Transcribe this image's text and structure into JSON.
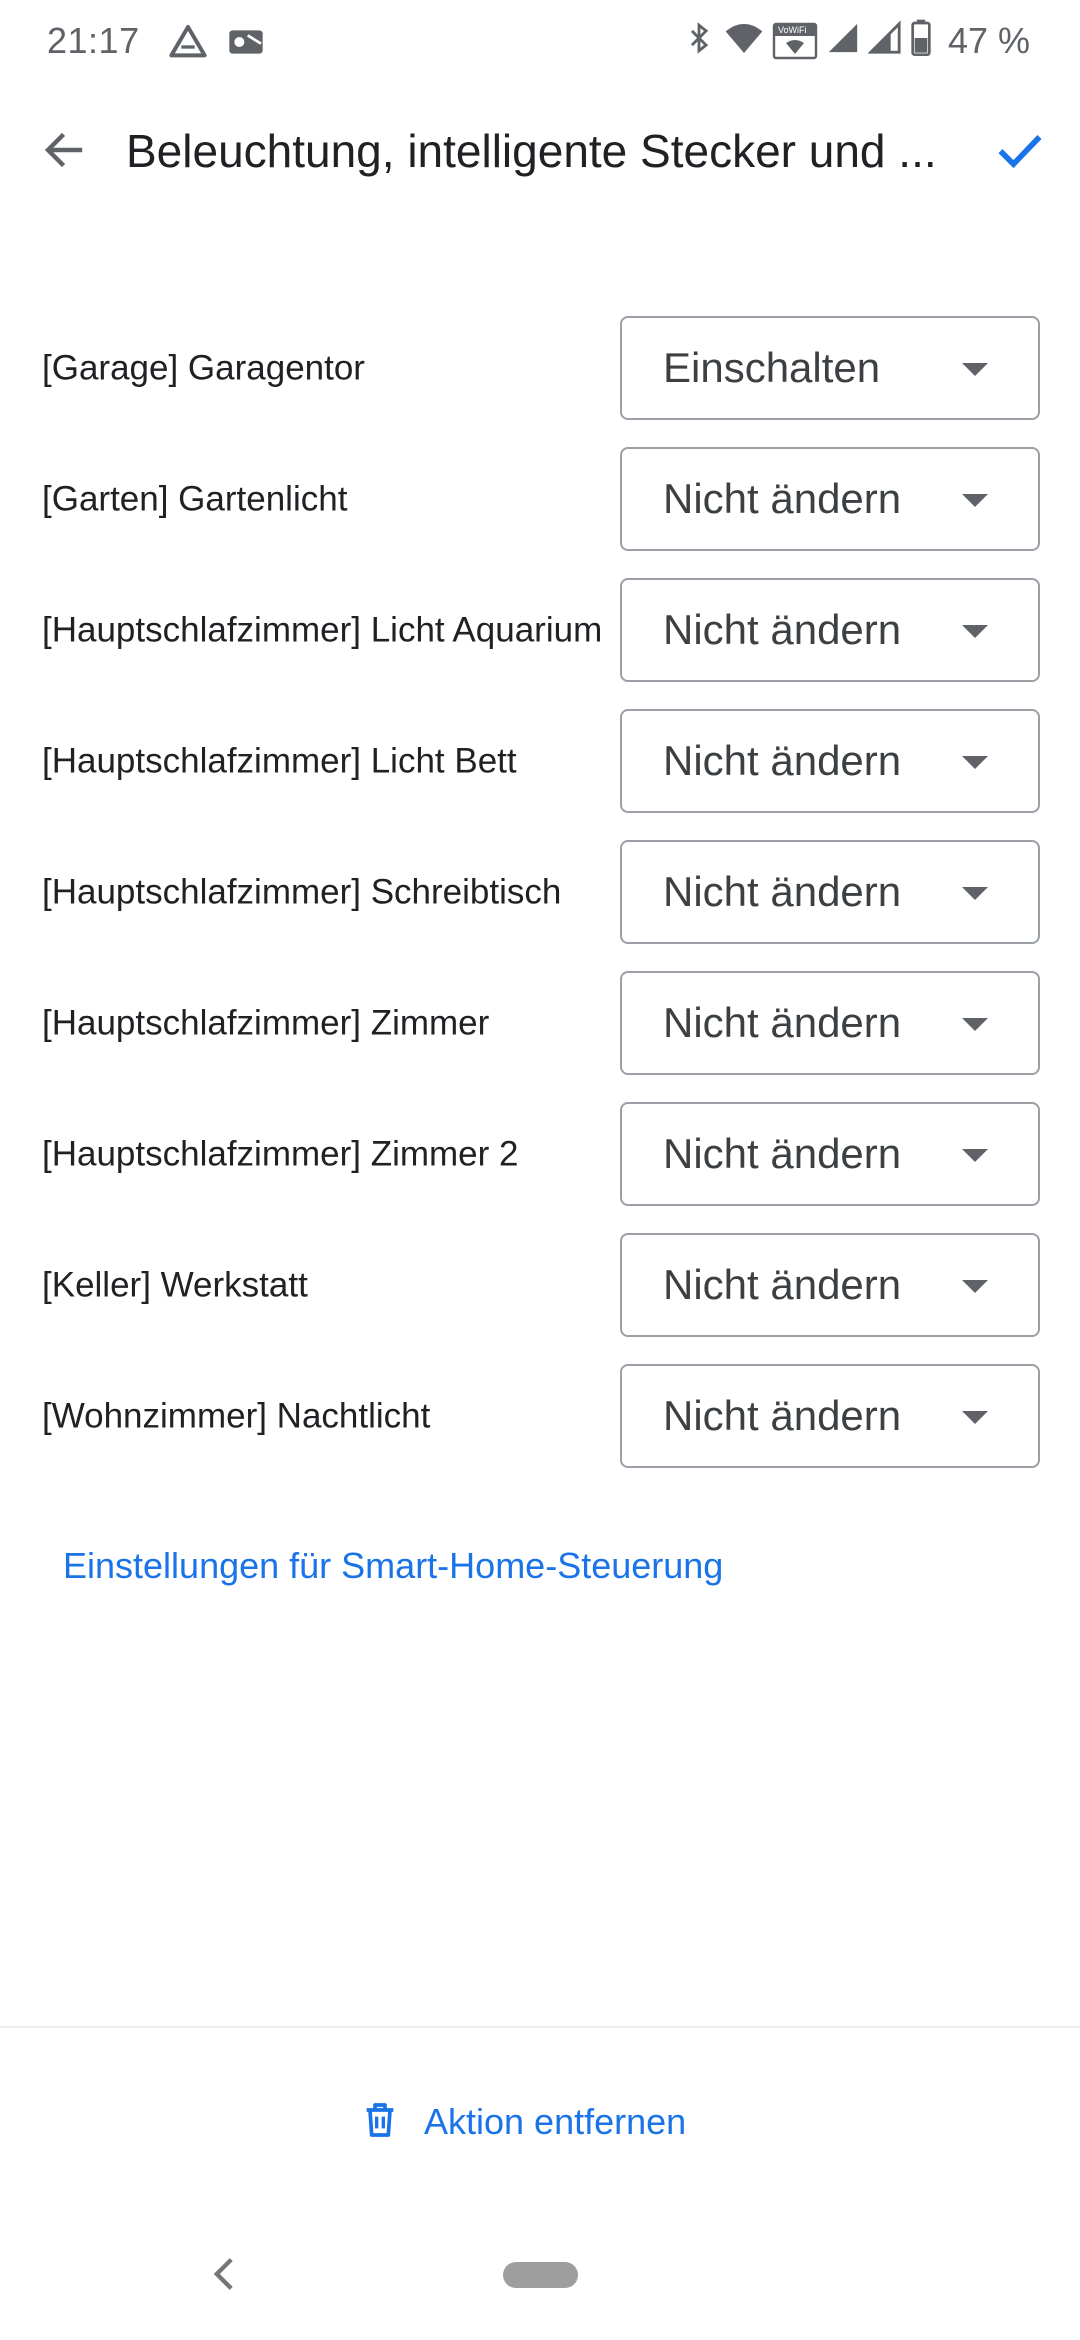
{
  "status_bar": {
    "time": "21:17",
    "left_icons": [
      "drive-icon",
      "outlook-icon"
    ],
    "right_icons": [
      "bluetooth-icon",
      "wifi-icon",
      "vowifi-icon",
      "signal-icon",
      "signal-icon",
      "battery-icon"
    ],
    "vowifi_text": "VoWiFi",
    "battery_percent": "47 %"
  },
  "app_bar": {
    "title": "Beleuchtung, intelligente Stecker und ...",
    "back_icon": "arrow-back-icon",
    "confirm_icon": "check-icon"
  },
  "devices": [
    {
      "label": "[Garage] Garagentor",
      "value": "Einschalten"
    },
    {
      "label": "[Garten] Gartenlicht",
      "value": "Nicht ändern"
    },
    {
      "label": "[Hauptschlafzimmer] Licht Aquarium",
      "value": "Nicht ändern"
    },
    {
      "label": "[Hauptschlafzimmer] Licht Bett",
      "value": "Nicht ändern"
    },
    {
      "label": "[Hauptschlafzimmer] Schreibtisch",
      "value": "Nicht ändern"
    },
    {
      "label": "[Hauptschlafzimmer] Zimmer",
      "value": "Nicht ändern"
    },
    {
      "label": "[Hauptschlafzimmer] Zimmer 2",
      "value": "Nicht ändern"
    },
    {
      "label": "[Keller] Werkstatt",
      "value": "Nicht ändern"
    },
    {
      "label": "[Wohnzimmer] Nachtlicht",
      "value": "Nicht ändern"
    }
  ],
  "settings_link": "Einstellungen für Smart-Home-Steuerung",
  "remove_action": {
    "label": "Aktion entfernen",
    "icon": "trash-icon"
  },
  "colors": {
    "accent": "#1a73e8",
    "text": "#202124",
    "muted": "#5f6368",
    "border": "#9aa0a6"
  }
}
